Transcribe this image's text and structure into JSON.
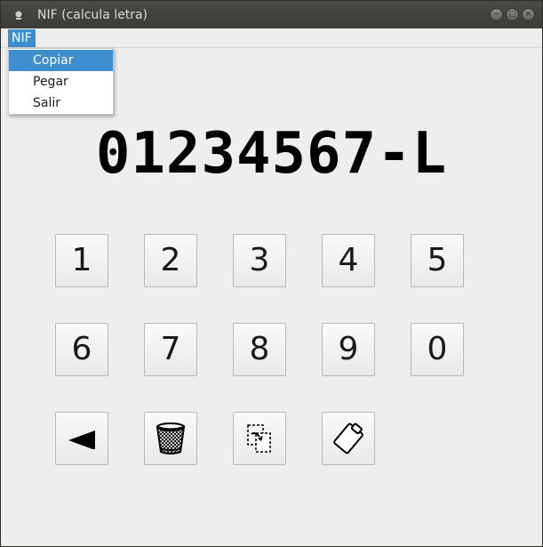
{
  "window": {
    "title": "NIF (calcula letra)",
    "controls": [
      "minimize",
      "maximize",
      "close"
    ]
  },
  "menubar": {
    "menu_title": "NIF"
  },
  "menu": {
    "items": [
      {
        "label": "Copiar",
        "highlighted": true
      },
      {
        "label": "Pegar",
        "highlighted": false
      },
      {
        "label": "Salir",
        "highlighted": false
      }
    ]
  },
  "display": {
    "value": "01234567-L"
  },
  "keypad": {
    "digits": [
      "1",
      "2",
      "3",
      "4",
      "5",
      "6",
      "7",
      "8",
      "9",
      "0"
    ],
    "actions": [
      {
        "name": "backspace",
        "icon": "left-triangle-icon"
      },
      {
        "name": "clear",
        "icon": "trash-bin-icon"
      },
      {
        "name": "paste",
        "icon": "paste-document-icon"
      },
      {
        "name": "copy",
        "icon": "clipboard-icon"
      }
    ]
  },
  "colors": {
    "titlebar": "#3c3b37",
    "menu_highlight": "#3d8fd0",
    "window_bg": "#eeeeee"
  }
}
